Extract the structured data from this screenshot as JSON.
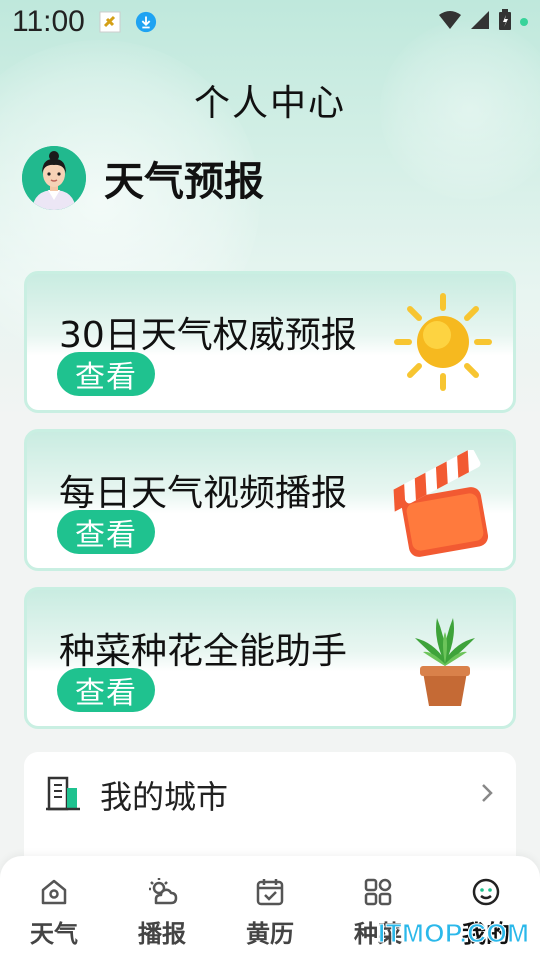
{
  "status_bar": {
    "time": "11:00",
    "icons": [
      "app-notification-icon",
      "download-icon",
      "wifi-icon",
      "signal-icon",
      "battery-icon"
    ]
  },
  "header": {
    "title": "个人中心"
  },
  "profile": {
    "name": "天气预报",
    "avatar_icon": "avatar-woman-icon"
  },
  "cards": [
    {
      "title": "30日天气权威预报",
      "button": "查看",
      "art": "sun-icon"
    },
    {
      "title": "每日天气视频播报",
      "button": "查看",
      "art": "clapperboard-icon"
    },
    {
      "title": "种菜种花全能助手",
      "button": "查看",
      "art": "succulent-plant-icon"
    }
  ],
  "city": {
    "label": "我的城市",
    "icon": "buildings-icon"
  },
  "tabs": [
    {
      "label": "天气",
      "icon": "home-icon",
      "active": false
    },
    {
      "label": "播报",
      "icon": "weather-cloud-icon",
      "active": false
    },
    {
      "label": "黄历",
      "icon": "calendar-icon",
      "active": false
    },
    {
      "label": "种菜",
      "icon": "grid-icon",
      "active": false
    },
    {
      "label": "我的",
      "icon": "smile-icon",
      "active": true
    }
  ],
  "watermark": "ITMOP.COM",
  "colors": {
    "accent": "#1fc28f",
    "card_border": "#c9efe2",
    "background": "#f2f4f3"
  }
}
